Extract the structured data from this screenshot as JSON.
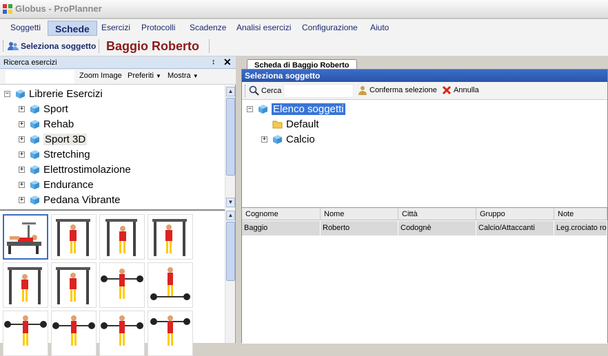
{
  "window": {
    "title": "Globus - ProPlanner"
  },
  "menu": [
    "Soggetti",
    "Schede",
    "Esercizi",
    "Protocolli",
    "Scadenze",
    "Analisi esercizi",
    "Configurazione",
    "Aiuto"
  ],
  "toolbar": {
    "select_label": "Seleziona soggetto",
    "subject_name": "Baggio Roberto"
  },
  "left_panel": {
    "title": "Ricerca esercizi",
    "tools": {
      "zoom": "Zoom Image",
      "preferiti": "Preferiti",
      "mostra": "Mostra"
    },
    "tree_root": "Librerie Esercizi",
    "tree_items": [
      "Sport",
      "Rehab",
      "Sport 3D",
      "Stretching",
      "Elettrostimolazione",
      "Endurance",
      "Pedana Vibrante"
    ]
  },
  "tab": {
    "label": "Scheda di Baggio Roberto"
  },
  "dialog": {
    "title": "Seleziona soggetto",
    "search_label": "Cerca",
    "confirm_label": "Conferma selezione",
    "cancel_label": "Annulla",
    "tree_root": "Elenco soggetti",
    "tree_items": [
      "Default",
      "Calcio"
    ],
    "columns": [
      "Cognome",
      "Nome",
      "Città",
      "Gruppo",
      "Note"
    ],
    "rows": [
      [
        "Baggio",
        "Roberto",
        "Codognè",
        "Calcio/Attaccanti",
        "Leg.crociato ro"
      ]
    ]
  },
  "colors": {
    "selection": "#3875d7",
    "name_red": "#8b1a1a",
    "menu_text": "#1a2a6e"
  }
}
